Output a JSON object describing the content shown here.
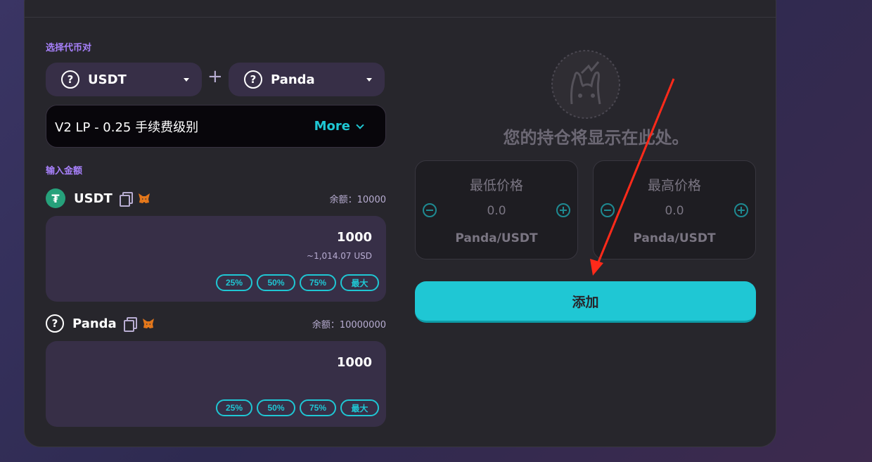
{
  "pair_section": {
    "label": "选择代币对"
  },
  "token_a": {
    "symbol": "USDT"
  },
  "plus": "+",
  "token_b": {
    "symbol": "Panda"
  },
  "fee_tier": {
    "text": "V2 LP - 0.25 手续费级别",
    "more_label": "More"
  },
  "amount_section": {
    "label": "输入金额"
  },
  "input_a": {
    "symbol": "USDT",
    "balance": "余额：10000",
    "value": "1000",
    "usd_value": "~1,014.07 USD",
    "icon_glyph": "₮"
  },
  "input_b": {
    "symbol": "Panda",
    "balance": "余额：10000000",
    "value": "1000"
  },
  "percent_buttons": [
    "25%",
    "50%",
    "75%",
    "最大"
  ],
  "position_empty_text": "您的持仓将显示在此处。",
  "min_price": {
    "title": "最低价格",
    "value": "0.0",
    "pair": "Panda/USDT"
  },
  "max_price": {
    "title": "最高价格",
    "value": "0.0",
    "pair": "Panda/USDT"
  },
  "add_button": "添加",
  "question_glyph": "?",
  "colors": {
    "accent": "#1fc7d4",
    "purple": "#a881fc",
    "annotation_arrow": "#ff2a1a"
  },
  "icons": [
    "question-icon",
    "caret-down-icon",
    "chevron-down-icon",
    "tether-icon",
    "copy-icon",
    "metamask-icon",
    "minus-circle-icon",
    "plus-circle-icon",
    "bunny-empty-illustration"
  ]
}
